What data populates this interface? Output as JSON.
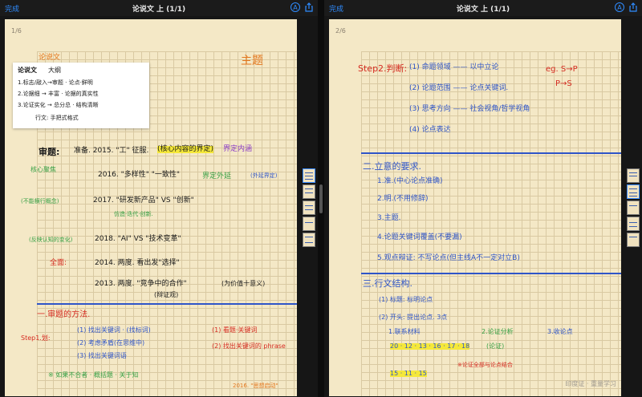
{
  "left": {
    "done_label": "完成",
    "title": "论说文 上 (1/1)",
    "page_num": "1/6",
    "texts": {
      "header": "论说文",
      "zhuti": "主题",
      "card_l1": "论说文",
      "card_l1b": "大纲",
      "card_l2": "1.标志/敲入→审题 · 论点·鲜明",
      "card_l3": "2.论据细 → 丰富 · 论据的真实性",
      "card_l4": "3.论证实化 → 总分总 · 结构清晰",
      "card_l5": "行文: 手把式格式",
      "shenti": "审题:",
      "y2015": "准备. 2015. \"工\" 征服.",
      "y2015b": "(核心内容的界定)",
      "y2015c": "界定内涵",
      "heyin": "核心聚焦",
      "y2016": "2016. \"多样性\" \"一致性\"",
      "y2016b": "界定外延",
      "y2016c": "(外延界定)",
      "bujie": "(不能横行概念)",
      "y2017": "2017. \"研发新产品\" VS \"创新\"",
      "y2017b": "仿造·迭代·创新.",
      "ai_note": "(反映认知的变化)",
      "y2018": "2018. \"AI\" VS \"技术变革\"",
      "quanmian": "全面:",
      "y2014": "2014. 两度. 看出发\"选择\"",
      "y2013": "2013. 两度. \"竞争中的合作\"",
      "y2013b": "(为价值十意义)",
      "y2013c": "(辩证观)",
      "sec1": "一.审题的方法.",
      "step1": "Step1.划:",
      "m1": "(1) 找出关键词 · (找标词)",
      "m2": "(2) 考虑矛盾(在思维中)",
      "m3": "(3) 找出关键词语",
      "m_note1": "(1) 看题·关键词",
      "m_note2": "(2) 找出关键词的 phrase",
      "bottom": "※ 如果不合者 · 概括题 · 关于知",
      "footer": "2016. \"思想启动\""
    }
  },
  "right": {
    "done_label": "完成",
    "title": "论说文 上 (1/1)",
    "page_num": "2/6",
    "texts": {
      "step2": "Step2.判断:",
      "j1": "(1) 命题领域 —— 以中立论",
      "j2": "(2) 论题范围 —— 论点关键词.",
      "j3": "(3) 思考方向 —— 社会视角/哲学视角",
      "j4": "(4) 论点表达",
      "eg": "eg. S→P",
      "eg2": "P→S",
      "sec2": "二.立意的要求.",
      "r1": "1.准.(中心论点准确)",
      "r2": "2.明.(不用修辞)",
      "r3": "3.主题.",
      "r4": "4.论题关键词覆盖(不要漏)",
      "r5": "5.观点辩证: 不写论点(但主线A不一定对立B)",
      "sec3": "三.行文结构.",
      "s1": "(1) 标题: 标明论点",
      "s2": "(2) 开头: 提出论点. 3点",
      "s3a": "1.联系材料",
      "s3b": "2.论证分析",
      "s3c": "3.收论点",
      "nums": "20 · 12 · 13 · 16 · 17 · 18",
      "nums2": "15 · 11 · 15",
      "verify": "(论证)",
      "note": "※论证全部与论点结合",
      "wm": "印度证 · 重量学习"
    }
  }
}
